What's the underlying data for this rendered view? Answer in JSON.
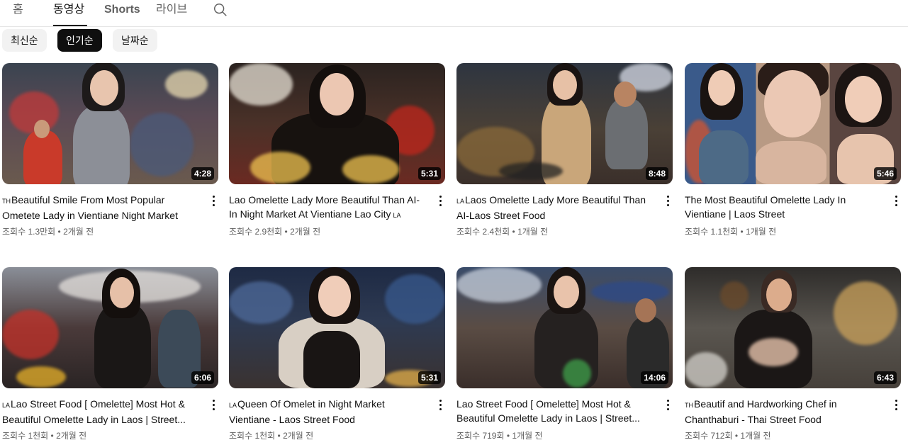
{
  "tabs": [
    {
      "label": "홈"
    },
    {
      "label": "동영상"
    },
    {
      "label": "Shorts"
    },
    {
      "label": "라이브"
    }
  ],
  "search": {
    "icon": "search-icon"
  },
  "chips": [
    {
      "label": "최신순"
    },
    {
      "label": "인기순"
    },
    {
      "label": "날짜순"
    }
  ],
  "videos": [
    {
      "badge": "TH",
      "title": "Beautiful Smile From Most Popular Ometete Lady in Vientiane Night Market",
      "views": "조회수 1.3만회",
      "age": "2개월 전",
      "duration": "4:28"
    },
    {
      "badge": "",
      "title": "Lao Omelette Lady More Beautiful Than AI- In Night Market At Vientiane Lao City",
      "badge_end": "LA",
      "views": "조회수 2.9천회",
      "age": "2개월 전",
      "duration": "5:31"
    },
    {
      "badge": "LA",
      "title": "Laos Omelette Lady More Beautiful Than AI-Laos Street Food",
      "views": "조회수 2.4천회",
      "age": "1개월 전",
      "duration": "8:48"
    },
    {
      "badge": "",
      "title": "The Most Beautiful Omelette Lady In Vientiane | Laos Street",
      "views": "조회수 1.1천회",
      "age": "1개월 전",
      "duration": "5:46"
    },
    {
      "badge": "LA",
      "title": "Lao Street Food [ Omelette] Most Hot & Beautiful Omelette Lady in Laos | Street...",
      "views": "조회수 1천회",
      "age": "2개월 전",
      "duration": "6:06"
    },
    {
      "badge": "LA",
      "title": "Queen Of Omelet in Night Market Vientiane - Laos Street Food",
      "views": "조회수 1천회",
      "age": "2개월 전",
      "duration": "5:31"
    },
    {
      "badge": "",
      "title": "Lao Street Food [ Omelette] Most Hot & Beautiful Omelette Lady in Laos | Street...",
      "views": "조회수 719회",
      "age": "1개월 전",
      "duration": "14:06"
    },
    {
      "badge": "TH",
      "title": "Beautif and Hardworking Chef in Chanthaburi - Thai Street Food",
      "views": "조회수 712회",
      "age": "1개월 전",
      "duration": "6:43"
    }
  ],
  "colors": {
    "accent": "#0f0f0f",
    "meta": "#606060",
    "chip_bg": "#f2f2f2"
  }
}
